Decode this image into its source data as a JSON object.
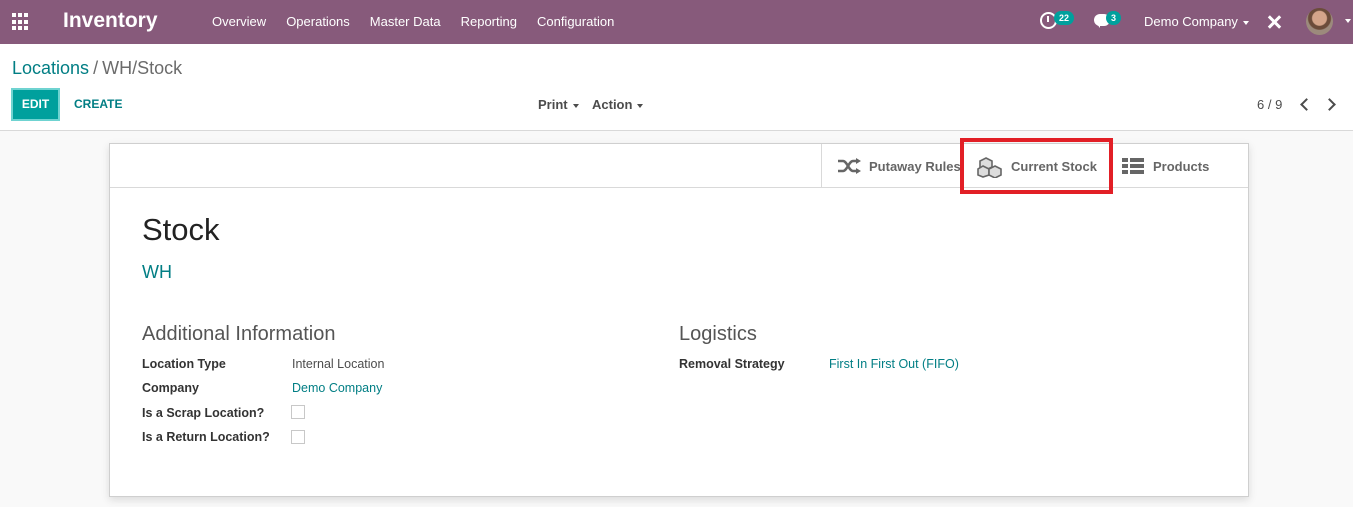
{
  "navbar": {
    "app_name": "Inventory",
    "menu": [
      "Overview",
      "Operations",
      "Master Data",
      "Reporting",
      "Configuration"
    ],
    "activity_count": "22",
    "message_count": "3",
    "company": "Demo Company",
    "bg_color": "#875a7b"
  },
  "breadcrumb": {
    "parent": "Locations",
    "separator": "/",
    "current": "WH/Stock"
  },
  "toolbar": {
    "edit_label": "EDIT",
    "create_label": "CREATE",
    "print_label": "Print",
    "action_label": "Action",
    "pager": "6 / 9"
  },
  "smart_buttons": {
    "putaway": "Putaway Rules",
    "current_stock": "Current Stock",
    "products": "Products"
  },
  "record": {
    "name": "Stock",
    "parent": "WH"
  },
  "additional": {
    "title": "Additional Information",
    "location_type_label": "Location Type",
    "location_type": "Internal Location",
    "company_label": "Company",
    "company": "Demo Company",
    "scrap_label": "Is a Scrap Location?",
    "scrap": false,
    "return_label": "Is a Return Location?",
    "return": false
  },
  "logistics": {
    "title": "Logistics",
    "removal_label": "Removal Strategy",
    "removal": "First In First Out (FIFO)"
  },
  "colors": {
    "accent": "#00a09d",
    "link": "#017e84",
    "highlight": "#e21f26"
  }
}
